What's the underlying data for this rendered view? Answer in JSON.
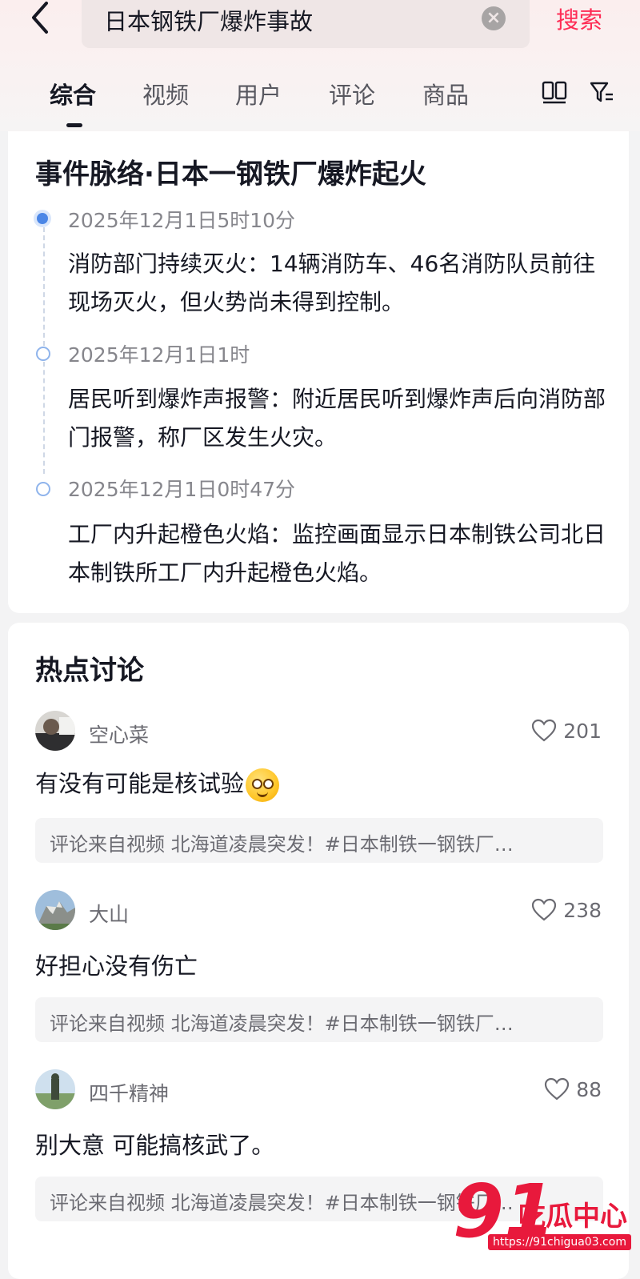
{
  "header": {
    "search_query": "日本钢铁厂爆炸事故",
    "search_button": "搜索",
    "tabs": [
      "综合",
      "视频",
      "用户",
      "评论",
      "商品"
    ],
    "active_tab": "综合"
  },
  "event_card": {
    "title": "事件脉络·日本一钢铁厂爆炸起火",
    "timeline": [
      {
        "time": "2025年12月1日5时10分",
        "desc": "消防部门持续灭火：14辆消防车、46名消防队员前往现场灭火，但火势尚未得到控制。"
      },
      {
        "time": "2025年12月1日1时",
        "desc": "居民听到爆炸声报警：附近居民听到爆炸声后向消防部门报警，称厂区发生火灾。"
      },
      {
        "time": "2025年12月1日0时47分",
        "desc": "工厂内升起橙色火焰：监控画面显示日本制铁公司北日本制铁所工厂内升起橙色火焰。"
      }
    ]
  },
  "discussion": {
    "title": "热点讨论",
    "comments": [
      {
        "user": "空心菜",
        "likes": "201",
        "text": "有没有可能是核试验",
        "source": "评论来自视频 北海道凌晨突发！#日本制铁一钢铁厂…"
      },
      {
        "user": "大山",
        "likes": "238",
        "text": "好担心没有伤亡",
        "source": "评论来自视频 北海道凌晨突发！#日本制铁一钢铁厂…"
      },
      {
        "user": "四千精神",
        "likes": "88",
        "text": "别大意 可能搞核武了。",
        "source": "评论来自视频 北海道凌晨突发！#日本制铁一钢铁厂…"
      }
    ]
  },
  "watermark": {
    "number": "91",
    "name": "吃瓜中心",
    "url": "https://91chigua03.com"
  },
  "colors": {
    "accent": "#fe2c55",
    "timeline_dot": "#4b86e6",
    "watermark": "#e8193c"
  }
}
